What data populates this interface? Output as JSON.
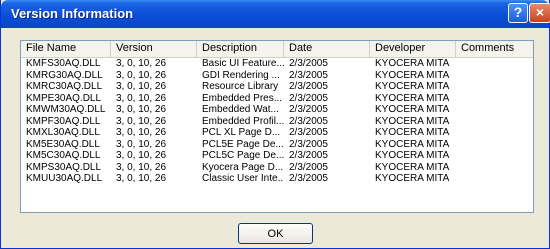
{
  "window": {
    "title": "Version Information"
  },
  "titlebar": {
    "help": "?",
    "close": "×"
  },
  "table": {
    "columns": [
      "File Name",
      "Version",
      "Description",
      "Date",
      "Developer",
      "Comments"
    ],
    "rows": [
      [
        "KMFS30AQ.DLL",
        "3, 0, 10, 26",
        "Basic UI Feature...",
        "2/3/2005",
        "KYOCERA MITA",
        ""
      ],
      [
        "KMRG30AQ.DLL",
        "3, 0, 10, 26",
        "GDI Rendering ...",
        "2/3/2005",
        "KYOCERA MITA",
        ""
      ],
      [
        "KMRC30AQ.DLL",
        "3, 0, 10, 26",
        "Resource Library",
        "2/3/2005",
        "KYOCERA MITA",
        ""
      ],
      [
        "KMPE30AQ.DLL",
        "3, 0, 10, 26",
        "Embedded Pres...",
        "2/3/2005",
        "KYOCERA MITA",
        ""
      ],
      [
        "KMWM30AQ.DLL",
        "3, 0, 10, 26",
        "Embedded Wat...",
        "2/3/2005",
        "KYOCERA MITA",
        ""
      ],
      [
        "KMPF30AQ.DLL",
        "3, 0, 10, 26",
        "Embedded Profil...",
        "2/3/2005",
        "KYOCERA MITA",
        ""
      ],
      [
        "KMXL30AQ.DLL",
        "3, 0, 10, 26",
        "PCL XL Page D...",
        "2/3/2005",
        "KYOCERA MITA",
        ""
      ],
      [
        "KM5E30AQ.DLL",
        "3, 0, 10, 26",
        "PCL5E Page De...",
        "2/3/2005",
        "KYOCERA MITA",
        ""
      ],
      [
        "KM5C30AQ.DLL",
        "3, 0, 10, 26",
        "PCL5C Page De...",
        "2/3/2005",
        "KYOCERA MITA",
        ""
      ],
      [
        "KMPS30AQ.DLL",
        "3, 0, 10, 26",
        "Kyocera Page D...",
        "2/3/2005",
        "KYOCERA MITA",
        ""
      ],
      [
        "KMUU30AQ.DLL",
        "3, 0, 10, 26",
        "Classic User Inte...",
        "2/3/2005",
        "KYOCERA MITA",
        ""
      ]
    ]
  },
  "buttons": {
    "ok": "OK"
  }
}
